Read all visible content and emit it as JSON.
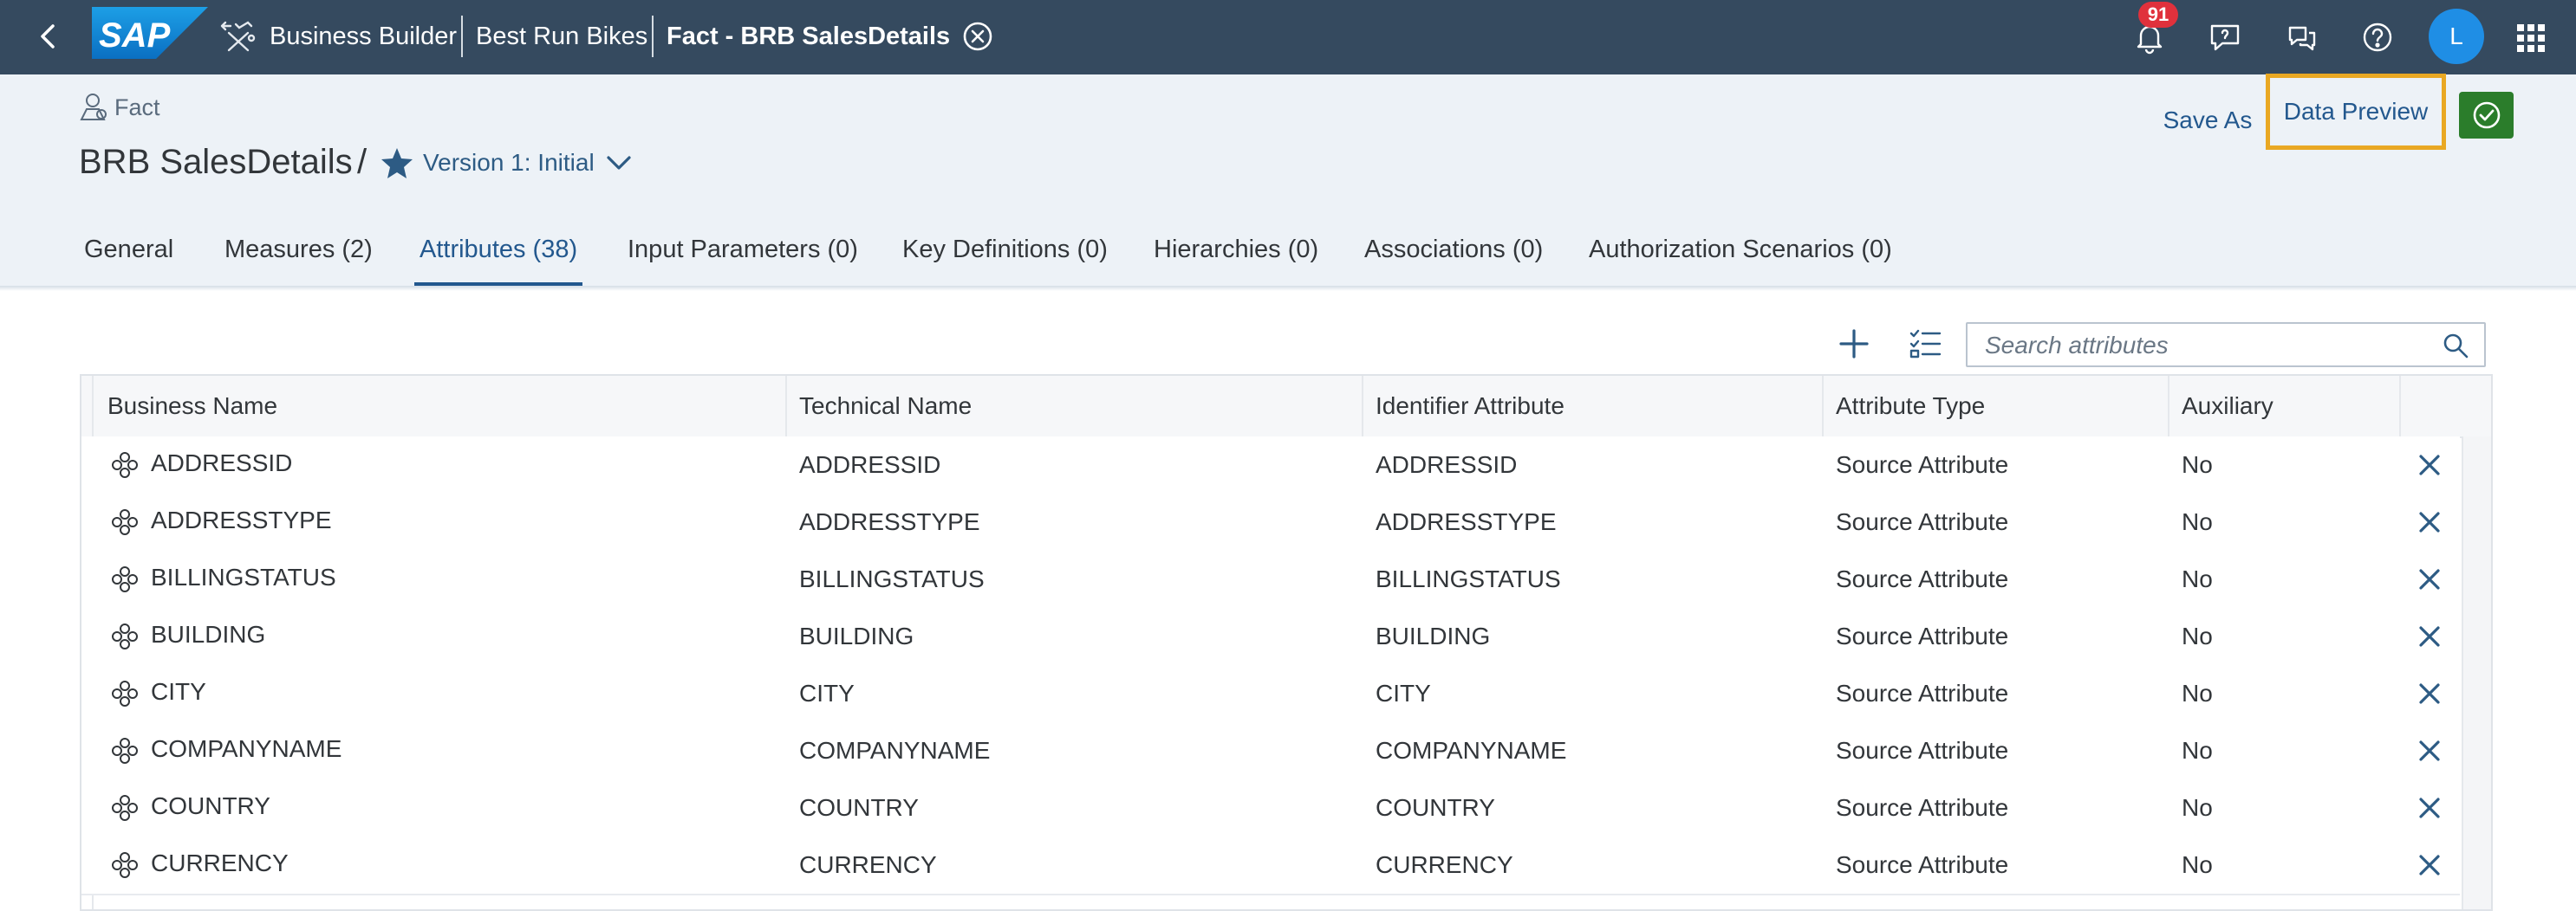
{
  "shellbar": {
    "logo_text": "SAP",
    "crumbs": [
      "Business Builder",
      "Best Run Bikes",
      "Fact - BRB SalesDetails"
    ],
    "notification_count": "91",
    "avatar_initial": "L",
    "colors": {
      "background": "#354a5f",
      "badge": "#e0313c",
      "avatar": "#1f8ee5"
    }
  },
  "header": {
    "object_type": "Fact",
    "title": "BRB SalesDetails",
    "separator": "/",
    "version_label": "Version 1: Initial",
    "save_as_label": "Save As",
    "data_preview_label": "Data Preview",
    "highlight_color": "#e9a823",
    "accent_color": "#2b7d2b"
  },
  "tabs": [
    {
      "label": "General"
    },
    {
      "label": "Measures (2)"
    },
    {
      "label": "Attributes (38)"
    },
    {
      "label": "Input Parameters (0)"
    },
    {
      "label": "Key Definitions (0)"
    },
    {
      "label": "Hierarchies (0)"
    },
    {
      "label": "Associations (0)"
    },
    {
      "label": "Authorization Scenarios (0)"
    }
  ],
  "active_tab": "Attributes (38)",
  "toolbar": {
    "search_placeholder": "Search attributes"
  },
  "table": {
    "columns": [
      "Business Name",
      "Technical Name",
      "Identifier Attribute",
      "Attribute Type",
      "Auxiliary"
    ],
    "rows": [
      {
        "business_name": "ADDRESSID",
        "technical_name": "ADDRESSID",
        "identifier": "ADDRESSID",
        "type": "Source Attribute",
        "auxiliary": "No"
      },
      {
        "business_name": "ADDRESSTYPE",
        "technical_name": "ADDRESSTYPE",
        "identifier": "ADDRESSTYPE",
        "type": "Source Attribute",
        "auxiliary": "No"
      },
      {
        "business_name": "BILLINGSTATUS",
        "technical_name": "BILLINGSTATUS",
        "identifier": "BILLINGSTATUS",
        "type": "Source Attribute",
        "auxiliary": "No"
      },
      {
        "business_name": "BUILDING",
        "technical_name": "BUILDING",
        "identifier": "BUILDING",
        "type": "Source Attribute",
        "auxiliary": "No"
      },
      {
        "business_name": "CITY",
        "technical_name": "CITY",
        "identifier": "CITY",
        "type": "Source Attribute",
        "auxiliary": "No"
      },
      {
        "business_name": "COMPANYNAME",
        "technical_name": "COMPANYNAME",
        "identifier": "COMPANYNAME",
        "type": "Source Attribute",
        "auxiliary": "No"
      },
      {
        "business_name": "COUNTRY",
        "technical_name": "COUNTRY",
        "identifier": "COUNTRY",
        "type": "Source Attribute",
        "auxiliary": "No"
      },
      {
        "business_name": "CURRENCY",
        "technical_name": "CURRENCY",
        "identifier": "CURRENCY",
        "type": "Source Attribute",
        "auxiliary": "No"
      }
    ]
  }
}
